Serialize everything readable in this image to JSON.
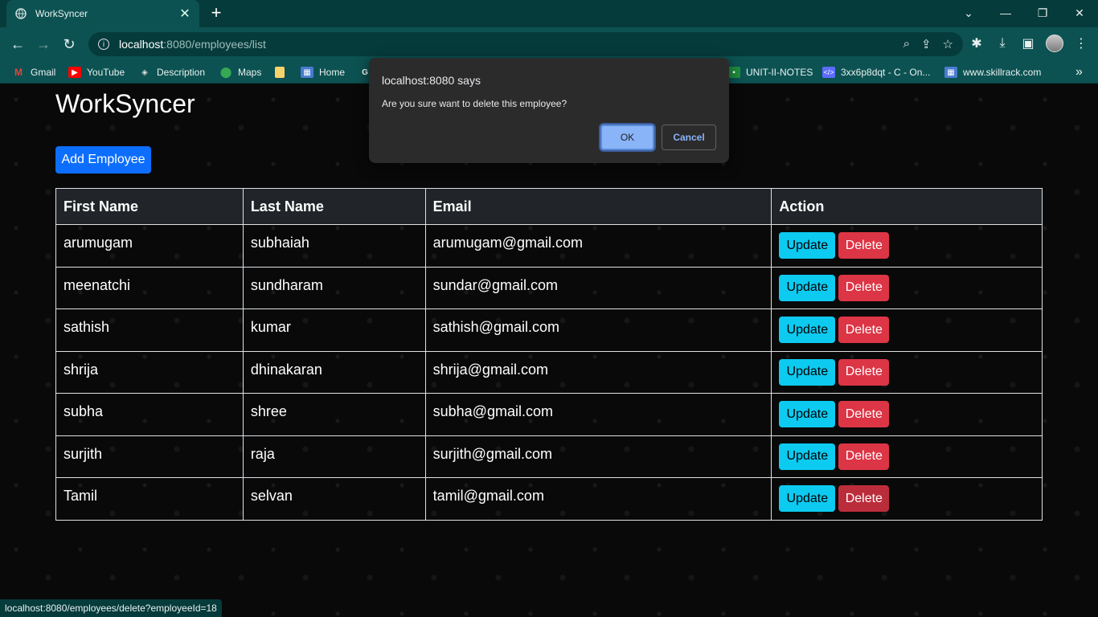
{
  "browser": {
    "tab_title": "WorkSyncer",
    "url_host": "localhost",
    "url_rest": ":8080/employees/list",
    "bookmarks": [
      {
        "label": "Gmail",
        "icon": "gmail-icon",
        "color": "#ea4335"
      },
      {
        "label": "YouTube",
        "icon": "youtube-icon",
        "color": "#ff0000"
      },
      {
        "label": "Description",
        "icon": "description-icon",
        "color": "#444444"
      },
      {
        "label": "Maps",
        "icon": "maps-icon",
        "color": "#34a853"
      },
      {
        "label": "",
        "icon": "folder-icon",
        "color": "#f6d36b"
      },
      {
        "label": "Home",
        "icon": "home-icon",
        "color": "#4a7bd0"
      },
      {
        "label": "",
        "icon": "google-icon",
        "color": "#ffffff"
      },
      {
        "label": "UNIT-II-NOTES",
        "icon": "classroom-icon",
        "color": "#1e8e3e"
      },
      {
        "label": "3xx6p8dqt - C - On...",
        "icon": "code-icon",
        "color": "#5b6cff"
      },
      {
        "label": "www.skillrack.com",
        "icon": "skillrack-icon",
        "color": "#4a7bd0"
      }
    ],
    "bookmarks_overflow": "»",
    "status_text": "localhost:8080/employees/delete?employeeId=18"
  },
  "app": {
    "title": "WorkSyncer",
    "add_button": "Add Employee",
    "table": {
      "headers": [
        "First Name",
        "Last Name",
        "Email",
        "Action"
      ],
      "update_label": "Update",
      "delete_label": "Delete",
      "rows": [
        {
          "first": "arumugam",
          "last": "subhaiah",
          "email": "arumugam@gmail.com"
        },
        {
          "first": "meenatchi",
          "last": "sundharam",
          "email": "sundar@gmail.com"
        },
        {
          "first": "sathish",
          "last": "kumar",
          "email": "sathish@gmail.com"
        },
        {
          "first": "shrija",
          "last": "dhinakaran",
          "email": "shrija@gmail.com"
        },
        {
          "first": "subha",
          "last": "shree",
          "email": "subha@gmail.com"
        },
        {
          "first": "surjith",
          "last": "raja",
          "email": "surjith@gmail.com"
        },
        {
          "first": "Tamil",
          "last": "selvan",
          "email": "tamil@gmail.com"
        }
      ]
    }
  },
  "dialog": {
    "title": "localhost:8080 says",
    "message": "Are you sure want to delete this employee?",
    "ok_label": "OK",
    "cancel_label": "Cancel"
  }
}
